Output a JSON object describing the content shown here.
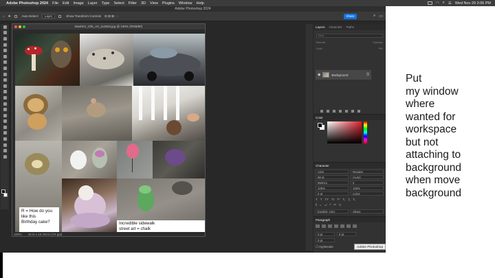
{
  "menubar": {
    "app_name": "Adobe Photoshop 2024",
    "menus": [
      "File",
      "Edit",
      "Image",
      "Layer",
      "Type",
      "Select",
      "Filter",
      "3D",
      "View",
      "Plugins",
      "Window",
      "Help"
    ],
    "clock": "Wed Nov 29  3:06 PM"
  },
  "window": {
    "title": "Adobe Photoshop 2024"
  },
  "options_bar": {
    "auto_select_label": "Auto-Select:",
    "layer_dropdown": "Layer",
    "transform_label": "Show Transform Controls",
    "share_label": "Share"
  },
  "document": {
    "tab_title": "Mushrm_Chk_Art_112823.jpg @ 100% (RGB/8#)",
    "zoom": "100%",
    "size_info": "15 in x 10.764 in (72 ppi)",
    "caption_question_lines": [
      "R  = How do you",
      "like this",
      "Birthday cake?"
    ],
    "caption_street_lines": [
      "Incredible sidewalk",
      "street art = chalk"
    ]
  },
  "panels": {
    "layer_tabs": [
      "Layers",
      "Channels",
      "Paths"
    ],
    "kind_label": "Kind",
    "mode_label": "Normal",
    "opacity_label": "Opacity:",
    "lock_label": "Lock:",
    "fill_label": "Fill:",
    "layer_name": "Background",
    "color_title": "Color",
    "character_title": "Character",
    "font_family": "Arial",
    "font_style": "Regular",
    "font_size": "58 pt",
    "leading": "(Auto)",
    "kerning": "Metrics",
    "tracking": "0",
    "vert_scale": "100%",
    "horiz_scale": "100%",
    "baseline": "0 pt",
    "color_label": "Color:",
    "language": "English: USA",
    "antialias": "Sharp",
    "paragraph_title": "Paragraph",
    "indent_values": [
      "0 pt",
      "0 pt",
      "0 pt"
    ],
    "hyphenate_label": "Hyphenate"
  },
  "tooltip": "Adobe Photoshop",
  "note_lines": [
    "Put",
    "my window",
    "where",
    "wanted for",
    "workspace",
    "but not",
    "attaching to",
    "background",
    "when move",
    "background"
  ],
  "colors": {
    "accent": "#1473e6",
    "window_bg": "#282828",
    "panel_bg": "#323232"
  }
}
